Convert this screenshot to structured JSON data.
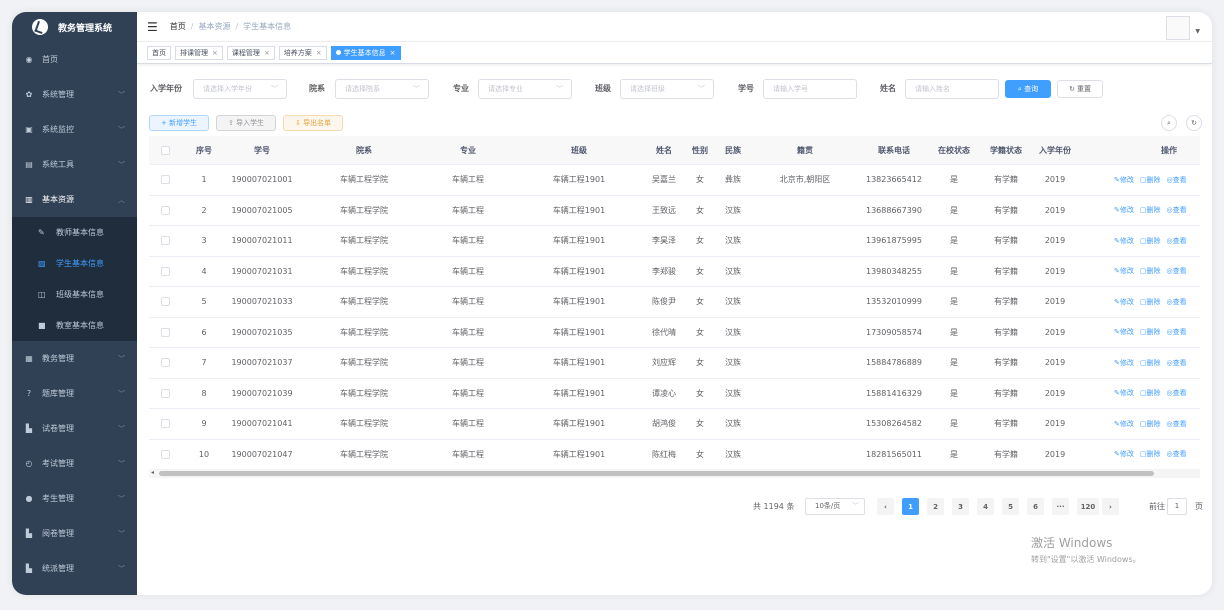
{
  "app": {
    "title": "教务管理系统"
  },
  "sidebar": {
    "items": [
      {
        "label": "首页",
        "icon": "dashboard-icon"
      },
      {
        "label": "系统管理",
        "icon": "gear-icon"
      },
      {
        "label": "系统监控",
        "icon": "monitor-icon"
      },
      {
        "label": "系统工具",
        "icon": "tool-icon"
      },
      {
        "label": "基本资源",
        "icon": "book-icon",
        "open": true,
        "children": [
          {
            "label": "教师基本信息",
            "icon": "edit-icon"
          },
          {
            "label": "学生基本信息",
            "icon": "doc-icon",
            "active": true
          },
          {
            "label": "班级基本信息",
            "icon": "chart-icon"
          },
          {
            "label": "教室基本信息",
            "icon": "square-icon"
          }
        ]
      },
      {
        "label": "教务管理",
        "icon": "print-icon"
      },
      {
        "label": "题库管理",
        "icon": "question-icon"
      },
      {
        "label": "试卷管理",
        "icon": "file-icon"
      },
      {
        "label": "考试管理",
        "icon": "clock-icon"
      },
      {
        "label": "考生管理",
        "icon": "user-icon"
      },
      {
        "label": "阅卷管理",
        "icon": "file-icon"
      },
      {
        "label": "统派管理",
        "icon": "file-icon"
      }
    ]
  },
  "breadcrumb": [
    "首页",
    "基本资源",
    "学生基本信息"
  ],
  "tags": [
    {
      "label": "首页"
    },
    {
      "label": "排课管理"
    },
    {
      "label": "课程管理"
    },
    {
      "label": "培养方案"
    },
    {
      "label": "学生基本信息",
      "active": true
    }
  ],
  "filters": {
    "enroll_label": "入学年份",
    "enroll_ph": "请选择入学年份",
    "college_label": "院系",
    "college_ph": "请选择院系",
    "major_label": "专业",
    "major_ph": "请选择专业",
    "class_label": "班级",
    "class_ph": "请选择班级",
    "sid_label": "学号",
    "sid_ph": "请输入学号",
    "name_label": "姓名",
    "name_ph": "请输入姓名",
    "search": "查询",
    "reset": "重置"
  },
  "toolbar": {
    "add": "+ 新增学生",
    "import": "⇪ 导入学生",
    "export": "⇩ 导出名单"
  },
  "table": {
    "headers": [
      "序号",
      "学号",
      "院系",
      "专业",
      "班级",
      "姓名",
      "性别",
      "民族",
      "籍贯",
      "联系电话",
      "在校状态",
      "学籍状态",
      "入学年份",
      "操作"
    ],
    "ops": [
      "修改",
      "删除",
      "查看"
    ],
    "rows": [
      [
        "1",
        "190007021001",
        "车辆工程学院",
        "车辆工程",
        "车辆工程1901",
        "吴嘉兰",
        "女",
        "彝族",
        "北京市,朝阳区",
        "13823665412",
        "是",
        "有学籍",
        "2019"
      ],
      [
        "2",
        "190007021005",
        "车辆工程学院",
        "车辆工程",
        "车辆工程1901",
        "王致远",
        "女",
        "汉族",
        "",
        "13688667390",
        "是",
        "有学籍",
        "2019"
      ],
      [
        "3",
        "190007021011",
        "车辆工程学院",
        "车辆工程",
        "车辆工程1901",
        "李昊泽",
        "女",
        "汉族",
        "",
        "13961875995",
        "是",
        "有学籍",
        "2019"
      ],
      [
        "4",
        "190007021031",
        "车辆工程学院",
        "车辆工程",
        "车辆工程1901",
        "李郑骏",
        "女",
        "汉族",
        "",
        "13980348255",
        "是",
        "有学籍",
        "2019"
      ],
      [
        "5",
        "190007021033",
        "车辆工程学院",
        "车辆工程",
        "车辆工程1901",
        "陈俊尹",
        "女",
        "汉族",
        "",
        "13532010999",
        "是",
        "有学籍",
        "2019"
      ],
      [
        "6",
        "190007021035",
        "车辆工程学院",
        "车辆工程",
        "车辆工程1901",
        "徐代晴",
        "女",
        "汉族",
        "",
        "17309058574",
        "是",
        "有学籍",
        "2019"
      ],
      [
        "7",
        "190007021037",
        "车辆工程学院",
        "车辆工程",
        "车辆工程1901",
        "刘应辉",
        "女",
        "汉族",
        "",
        "15884786889",
        "是",
        "有学籍",
        "2019"
      ],
      [
        "8",
        "190007021039",
        "车辆工程学院",
        "车辆工程",
        "车辆工程1901",
        "谭凌心",
        "女",
        "汉族",
        "",
        "15881416329",
        "是",
        "有学籍",
        "2019"
      ],
      [
        "9",
        "190007021041",
        "车辆工程学院",
        "车辆工程",
        "车辆工程1901",
        "胡鸿俊",
        "女",
        "汉族",
        "",
        "15308264582",
        "是",
        "有学籍",
        "2019"
      ],
      [
        "10",
        "190007021047",
        "车辆工程学院",
        "车辆工程",
        "车辆工程1901",
        "陈红梅",
        "女",
        "汉族",
        "",
        "18281565011",
        "是",
        "有学籍",
        "2019"
      ]
    ]
  },
  "pagination": {
    "total": "共 1194 条",
    "size": "10条/页",
    "pages": [
      "1",
      "2",
      "3",
      "4",
      "5",
      "6",
      "···",
      "120"
    ],
    "goto": "前往",
    "goto_value": "1",
    "page_unit": "页"
  },
  "watermark": {
    "line1": "激活 Windows",
    "line2": "转到\"设置\"以激活 Windows。"
  }
}
